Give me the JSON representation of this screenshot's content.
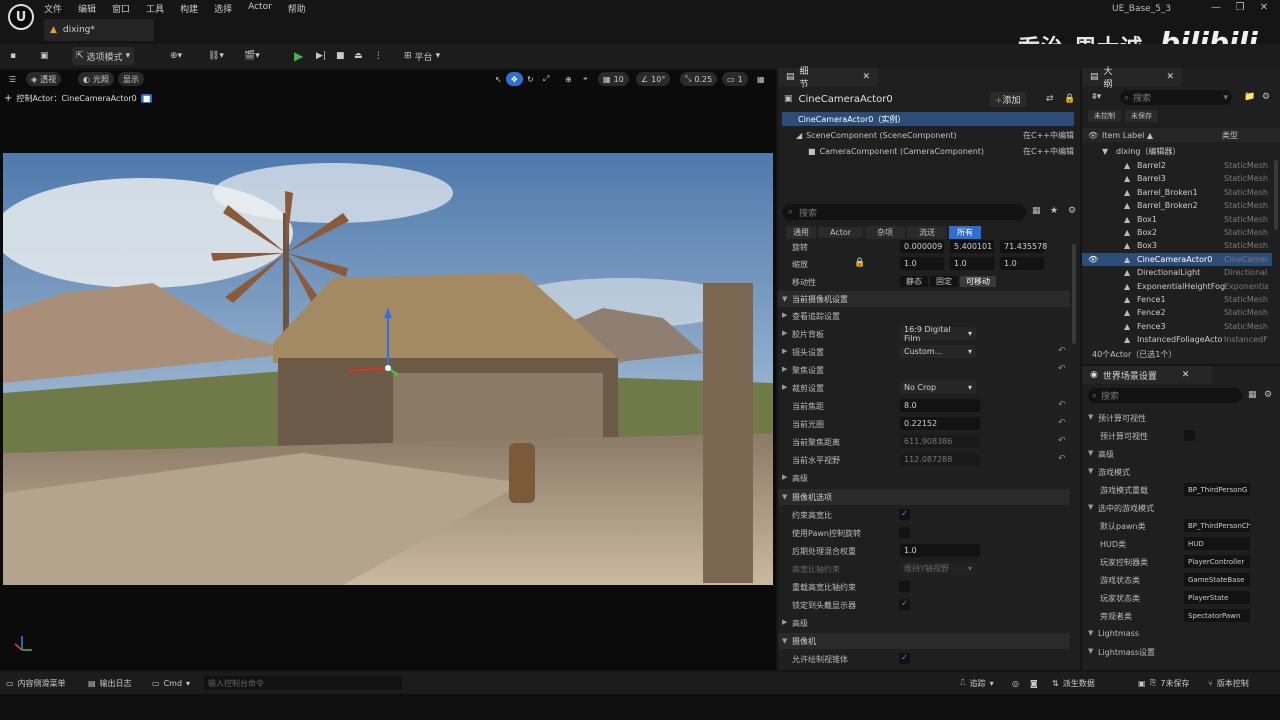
{
  "app": {
    "project": "UE_Base_5_3",
    "logo_glyph": "U",
    "document_tab": "dixing*"
  },
  "menu": [
    "文件",
    "编辑",
    "窗口",
    "工具",
    "构建",
    "选择",
    "Actor",
    "帮助"
  ],
  "window_controls": [
    "—",
    "❐",
    "✕"
  ],
  "watermark": {
    "text": "乔治-周士诚",
    "logo_text": "bilibili"
  },
  "toolbar": {
    "mode_label": "选项模式",
    "platform_label": "平台"
  },
  "viewport": {
    "perspective": "透视",
    "lit": "光照",
    "show": "显示",
    "grid_size": "10",
    "rotate_snap": "10°",
    "scale_snap": "0.25",
    "camera_speed": "1",
    "pilot_label": "控制Actor：CineCameraActor0"
  },
  "details": {
    "tab_title": "细节",
    "actor_name": "CineCameraActor0",
    "add_label": "添加",
    "components": [
      {
        "name": "CineCameraActor0（实例）",
        "link": ""
      },
      {
        "name": "SceneComponent (SceneComponent)",
        "link": "在C++中编辑"
      },
      {
        "name": "CameraComponent (CameraComponent)",
        "link": "在C++中编辑"
      }
    ],
    "search_placeholder": "搜索",
    "filters": [
      "通用",
      "Actor",
      "杂项",
      "流送",
      "所有"
    ],
    "rotation": {
      "label": "旋转",
      "x": "0.000009",
      "y": "5.400101",
      "z": "71.435578"
    },
    "scale": {
      "label": "缩放",
      "x": "1.0",
      "y": "1.0",
      "z": "1.0"
    },
    "mobility": {
      "label": "移动性",
      "options": [
        "静态",
        "固定",
        "可移动"
      ]
    },
    "sections": {
      "current_camera": "当前摄像机设置",
      "lookat": "查看追踪设置",
      "filmback": "胶片背板",
      "lens": "镜头设置",
      "focus": "聚焦设置",
      "crop": "裁剪设置",
      "focal": "当前焦距",
      "aperture": "当前光圈",
      "focus_dist": "当前聚焦距离",
      "hfov": "当前水平视野",
      "advanced1": "高级",
      "camera_options": "摄像机选项",
      "constrain": "约束高宽比",
      "pawn_rot": "使用Pawn控制旋转",
      "pp_blend": "后期处理混合权重",
      "aspect_axis": "高宽比轴约束",
      "override_aspect": "重载高宽比轴约束",
      "lock_hmd": "锁定到头戴显示器",
      "advanced2": "高级",
      "camera": "摄像机",
      "allow_cam": "允许绘制视锥体"
    },
    "values": {
      "filmback": "16:9 Digital Film",
      "lens": "Custom...",
      "crop": "No Crop",
      "focal": "8.0",
      "aperture": "0.22152",
      "focus_dist": "611.908386",
      "hfov": "112.087288",
      "pp_blend": "1.0",
      "aspect_axis": "维持Y轴视野"
    }
  },
  "outliner": {
    "tab_title": "大纲",
    "search_placeholder": "搜索",
    "filter_unsaved": "未控制",
    "filter_unsaved2": "未保存",
    "col_label": "Item Label ▲",
    "col_type": "类型",
    "root": "dixing（编辑器）",
    "items": [
      {
        "name": "Barrel2",
        "type": "StaticMesh"
      },
      {
        "name": "Barrel3",
        "type": "StaticMesh"
      },
      {
        "name": "Barrel_Broken1",
        "type": "StaticMesh"
      },
      {
        "name": "Barrel_Broken2",
        "type": "StaticMesh"
      },
      {
        "name": "Box1",
        "type": "StaticMesh"
      },
      {
        "name": "Box2",
        "type": "StaticMesh"
      },
      {
        "name": "Box3",
        "type": "StaticMesh"
      },
      {
        "name": "CineCameraActor0",
        "type": "CineCamer"
      },
      {
        "name": "DirectionalLight",
        "type": "DirectionalI"
      },
      {
        "name": "ExponentialHeightFog",
        "type": "Exponentia"
      },
      {
        "name": "Fence1",
        "type": "StaticMesh"
      },
      {
        "name": "Fence2",
        "type": "StaticMesh"
      },
      {
        "name": "Fence3",
        "type": "StaticMesh"
      },
      {
        "name": "InstancedFoliageActo",
        "type": "InstancedF"
      }
    ],
    "count": "40个Actor（已选1个）"
  },
  "world": {
    "tab_title": "世界场景设置",
    "search_placeholder": "搜索",
    "rows": [
      {
        "kind": "section",
        "label": "预计算可视性"
      },
      {
        "kind": "prop",
        "label": "预计算可视性",
        "value": ""
      },
      {
        "kind": "section",
        "label": "高级"
      },
      {
        "kind": "section",
        "label": "游戏模式"
      },
      {
        "kind": "prop",
        "label": "游戏模式重载",
        "value": "BP_ThirdPersonG"
      },
      {
        "kind": "section",
        "label": "选中的游戏模式"
      },
      {
        "kind": "prop",
        "label": "默认pawn类",
        "value": "BP_ThirdPersonCh"
      },
      {
        "kind": "prop",
        "label": "HUD类",
        "value": "HUD"
      },
      {
        "kind": "prop",
        "label": "玩家控制器类",
        "value": "PlayerController"
      },
      {
        "kind": "prop",
        "label": "游戏状态类",
        "value": "GameStateBase"
      },
      {
        "kind": "prop",
        "label": "玩家状态类",
        "value": "PlayerState"
      },
      {
        "kind": "prop",
        "label": "旁观者类",
        "value": "SpectatorPawn"
      },
      {
        "kind": "section",
        "label": "Lightmass"
      },
      {
        "kind": "section",
        "label": "Lightmass设置"
      }
    ]
  },
  "status": {
    "content_drawer": "内容侧滑菜单",
    "output_log": "输出日志",
    "cmd": "Cmd",
    "cmd_placeholder": "输入控制台命令",
    "trace": "追踪",
    "derived_data": "派生数据",
    "unsaved": "7未保存",
    "revision": "版本控制"
  }
}
